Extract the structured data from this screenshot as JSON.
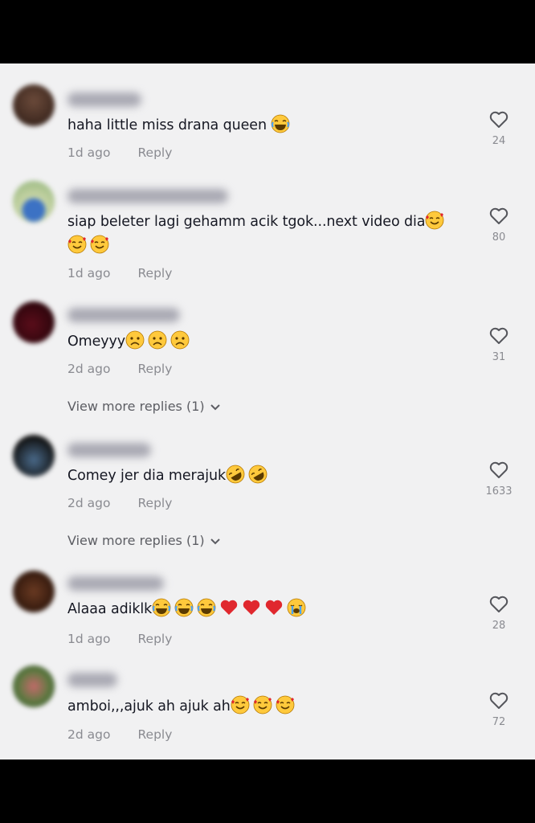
{
  "comments": [
    {
      "text": "haha little miss drana queen",
      "emojis": [
        "laugh-cry"
      ],
      "age": "1d ago",
      "reply": "Reply",
      "likes": "24"
    },
    {
      "text": "siap beleter lagi gehamm acik tgok...next video dia",
      "emojis": [
        "smiling-hearts",
        "smiling-hearts",
        "smiling-hearts"
      ],
      "age": "1d ago",
      "reply": "Reply",
      "likes": "80"
    },
    {
      "text": "Omeyyy",
      "emojis": [
        "frowning",
        "frowning",
        "frowning"
      ],
      "age": "2d ago",
      "reply": "Reply",
      "likes": "31",
      "more_replies": "View more replies (1)"
    },
    {
      "text": "Comey jer dia merajuk",
      "emojis": [
        "rofl",
        "rofl"
      ],
      "age": "2d ago",
      "reply": "Reply",
      "likes": "1633",
      "more_replies": "View more replies (1)"
    },
    {
      "text": "Alaaa adiklk",
      "emojis": [
        "laugh-cry",
        "laugh-cry",
        "laugh-cry",
        "red-heart",
        "red-heart",
        "red-heart",
        "loudly-crying"
      ],
      "age": "1d ago",
      "reply": "Reply",
      "likes": "28"
    },
    {
      "text": "amboi,,,ajuk ah ajuk ah",
      "emojis": [
        "smiling-hearts",
        "smiling-hearts",
        "smiling-hearts"
      ],
      "age": "2d ago",
      "reply": "Reply",
      "likes": "72"
    }
  ]
}
